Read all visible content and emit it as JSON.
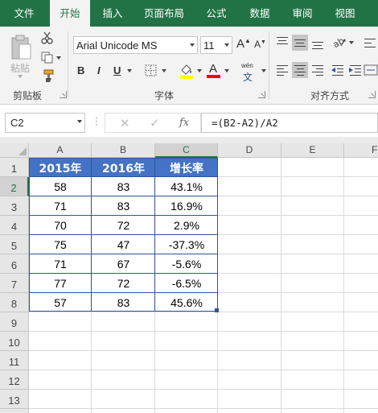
{
  "tabs": [
    "文件",
    "开始",
    "插入",
    "页面布局",
    "公式",
    "数据",
    "审阅",
    "视图"
  ],
  "active_tab": "开始",
  "ribbon": {
    "clipboard": {
      "paste_label": "粘贴",
      "group_label": "剪贴板"
    },
    "font": {
      "font_name": "Arial Unicode MS",
      "font_size": "11",
      "bold": "B",
      "italic": "I",
      "underline": "U",
      "grow": "A",
      "shrink": "A",
      "font_color_label": "A",
      "phonetic_label": "wén",
      "group_label": "字体"
    },
    "alignment": {
      "group_label": "对齐方式"
    }
  },
  "formula_bar": {
    "name_box": "C2",
    "cancel": "✕",
    "enter": "✓",
    "fx": "fx",
    "formula": "=(B2-A2)/A2"
  },
  "columns": [
    "A",
    "B",
    "C",
    "D",
    "E",
    "F"
  ],
  "selected_column": "C",
  "rows": [
    "1",
    "2",
    "3",
    "4",
    "5",
    "6",
    "7",
    "8",
    "9",
    "10",
    "11",
    "12",
    "13",
    "14"
  ],
  "selected_row": "2",
  "table": {
    "headers": [
      "2015年",
      "2016年",
      "增长率"
    ],
    "rows": [
      [
        "58",
        "83",
        "43.1%"
      ],
      [
        "71",
        "83",
        "16.9%"
      ],
      [
        "70",
        "72",
        "2.9%"
      ],
      [
        "75",
        "47",
        "-37.3%"
      ],
      [
        "71",
        "67",
        "-5.6%"
      ],
      [
        "77",
        "72",
        "-6.5%"
      ],
      [
        "57",
        "83",
        "45.6%"
      ]
    ]
  },
  "colors": {
    "accent": "#217346",
    "table_header": "#4472c4",
    "table_border": "#2f5597"
  }
}
